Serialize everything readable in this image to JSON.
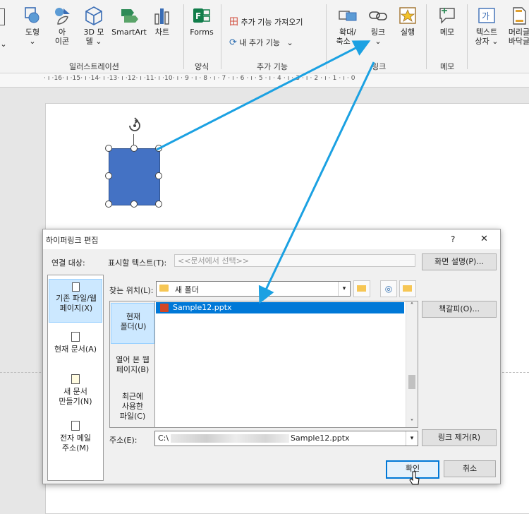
{
  "ribbon": {
    "items": [
      {
        "label1": "도형",
        "label2": "⌄"
      },
      {
        "label1": "아",
        "label2": "이콘"
      },
      {
        "label1": "3D 모",
        "label2": "델 ⌄"
      },
      {
        "label1": "SmartArt",
        "label2": ""
      },
      {
        "label1": "차트",
        "label2": ""
      },
      {
        "label1": "Forms",
        "label2": ""
      },
      {
        "label1": "확대/",
        "label2": "축소 ⌄"
      },
      {
        "label1": "링크",
        "label2": "⌄"
      },
      {
        "label1": "실행",
        "label2": ""
      },
      {
        "label1": "메모",
        "label2": ""
      },
      {
        "label1": "텍스트",
        "label2": "상자 ⌄"
      },
      {
        "label1": "머리글",
        "label2": "바닥글"
      }
    ],
    "get_addins": "추가 기능 가져오기",
    "my_addins": "내 추가 기능",
    "my_addins_arrow": "⌄",
    "groups": [
      "일러스트레이션",
      "양식",
      "추가 기능",
      "링크",
      "메모"
    ],
    "left_arrow": "⌄"
  },
  "ruler": {
    "text": "· ı ·16· ı ·15· ı ·14· ı ·13· ı ·12· ı ·11· ı ·10· ı · 9 · ı · 8 · ı · 7 · ı · 6 · ı · 5 · ı · 4 · ı · 3 · ı · 2 · ı · 1 · ı · 0"
  },
  "colors": {
    "shape_fill": "#4472c4",
    "arrow": "#1ba1e2",
    "selection": "#0078d7",
    "list_select": "#cce8ff"
  },
  "dialog": {
    "title": "하이퍼링크 편집",
    "help": "?",
    "close": "✕",
    "link_to_label": "연결 대상:",
    "display_text_label": "표시할 텍스트(T):",
    "display_text_value": "<<문서에서 선택>>",
    "screentip_button": "화면 설명(P)...",
    "look_in_label": "찾는 위치(L):",
    "look_in_value": "새 폴더",
    "bookmark_button": "책갈피(O)...",
    "address_label": "주소(E):",
    "address_prefix": "C:\\",
    "address_suffix": "Sample12.pptx",
    "remove_link_button": "링크 제거(R)",
    "ok_button": "확인",
    "cancel_button": "취소",
    "link_to_items": [
      {
        "line1": "기존 파일/웹",
        "line2": "페이지(X)"
      },
      {
        "line1": "현재 문서(A)",
        "line2": ""
      },
      {
        "line1": "새 문서",
        "line2": "만들기(N)"
      },
      {
        "line1": "전자 메일",
        "line2": "주소(M)"
      }
    ],
    "folder_items": [
      {
        "line1": "현재",
        "line2": "폴더(U)",
        "line3": ""
      },
      {
        "line1": "열어 본 웹",
        "line2": "페이지(B)",
        "line3": ""
      },
      {
        "line1": "최근에",
        "line2": "사용한",
        "line3": "파일(C)"
      }
    ],
    "files": [
      "Sample12.pptx"
    ]
  }
}
